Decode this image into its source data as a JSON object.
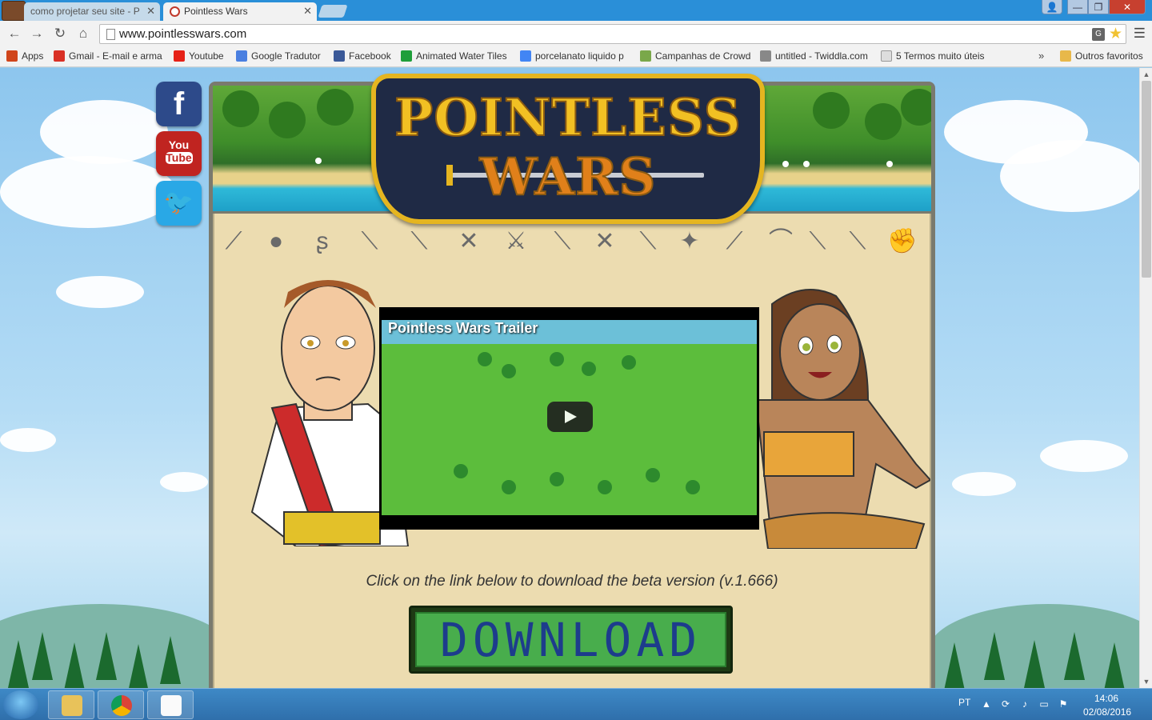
{
  "browser": {
    "tabs": [
      {
        "label": "como projetar seu site - P",
        "active": false
      },
      {
        "label": "Pointless Wars",
        "active": true
      }
    ],
    "url": "www.pointlesswars.com",
    "bookmarks": [
      {
        "label": "Apps",
        "color": "#d0451b"
      },
      {
        "label": "Gmail - E-mail e arma",
        "color": "#d93025"
      },
      {
        "label": "Youtube",
        "color": "#e62117"
      },
      {
        "label": "Google Tradutor",
        "color": "#4a7fe0"
      },
      {
        "label": "Facebook",
        "color": "#3b5998"
      },
      {
        "label": "Animated Water Tiles",
        "color": "#1f9e3a"
      },
      {
        "label": "porcelanato liquido p",
        "color": "#4285f4"
      },
      {
        "label": "Campanhas de Crowd",
        "color": "#7aa84a"
      },
      {
        "label": "untitled - Twiddla.com",
        "color": "#888888"
      },
      {
        "label": "5 Termos muito úteis",
        "color": "#999999"
      },
      {
        "label": "Outros favoritos",
        "color": "#e8b84a"
      }
    ],
    "more_label": "»"
  },
  "site": {
    "logo_line1": "POINTLESS",
    "logo_line2": "WARS",
    "video_title": "Pointless Wars Trailer",
    "download_text": "Click on the link below to download the beta version (v.1.666)",
    "download_button": "DOWNLOAD",
    "social": [
      "facebook-icon",
      "youtube-icon",
      "twitter-icon"
    ],
    "social_labels": {
      "facebook": "f",
      "youtube_top": "You",
      "youtube_bottom": "Tube",
      "twitter": "🐦"
    },
    "weapons": [
      "spear-icon",
      "bomb-icon",
      "sling-icon",
      "sword-icon",
      "staff-icon",
      "crossbow-icon",
      "axe-icon",
      "lance-icon",
      "dagger-icon",
      "halberd-icon",
      "shuriken-icon",
      "bow-icon",
      "whip-icon",
      "rapier-icon",
      "scimitar-icon",
      "gauntlet-icon"
    ]
  },
  "taskbar": {
    "language": "PT",
    "time": "14:06",
    "date": "02/08/2016",
    "apps": [
      "explorer-icon",
      "chrome-icon",
      "notepad-icon"
    ]
  },
  "colors": {
    "tabstrip": "#2a8fd8",
    "logo_gold": "#f2c023",
    "download_green": "#48ad4c",
    "download_text": "#1d3c8c"
  }
}
